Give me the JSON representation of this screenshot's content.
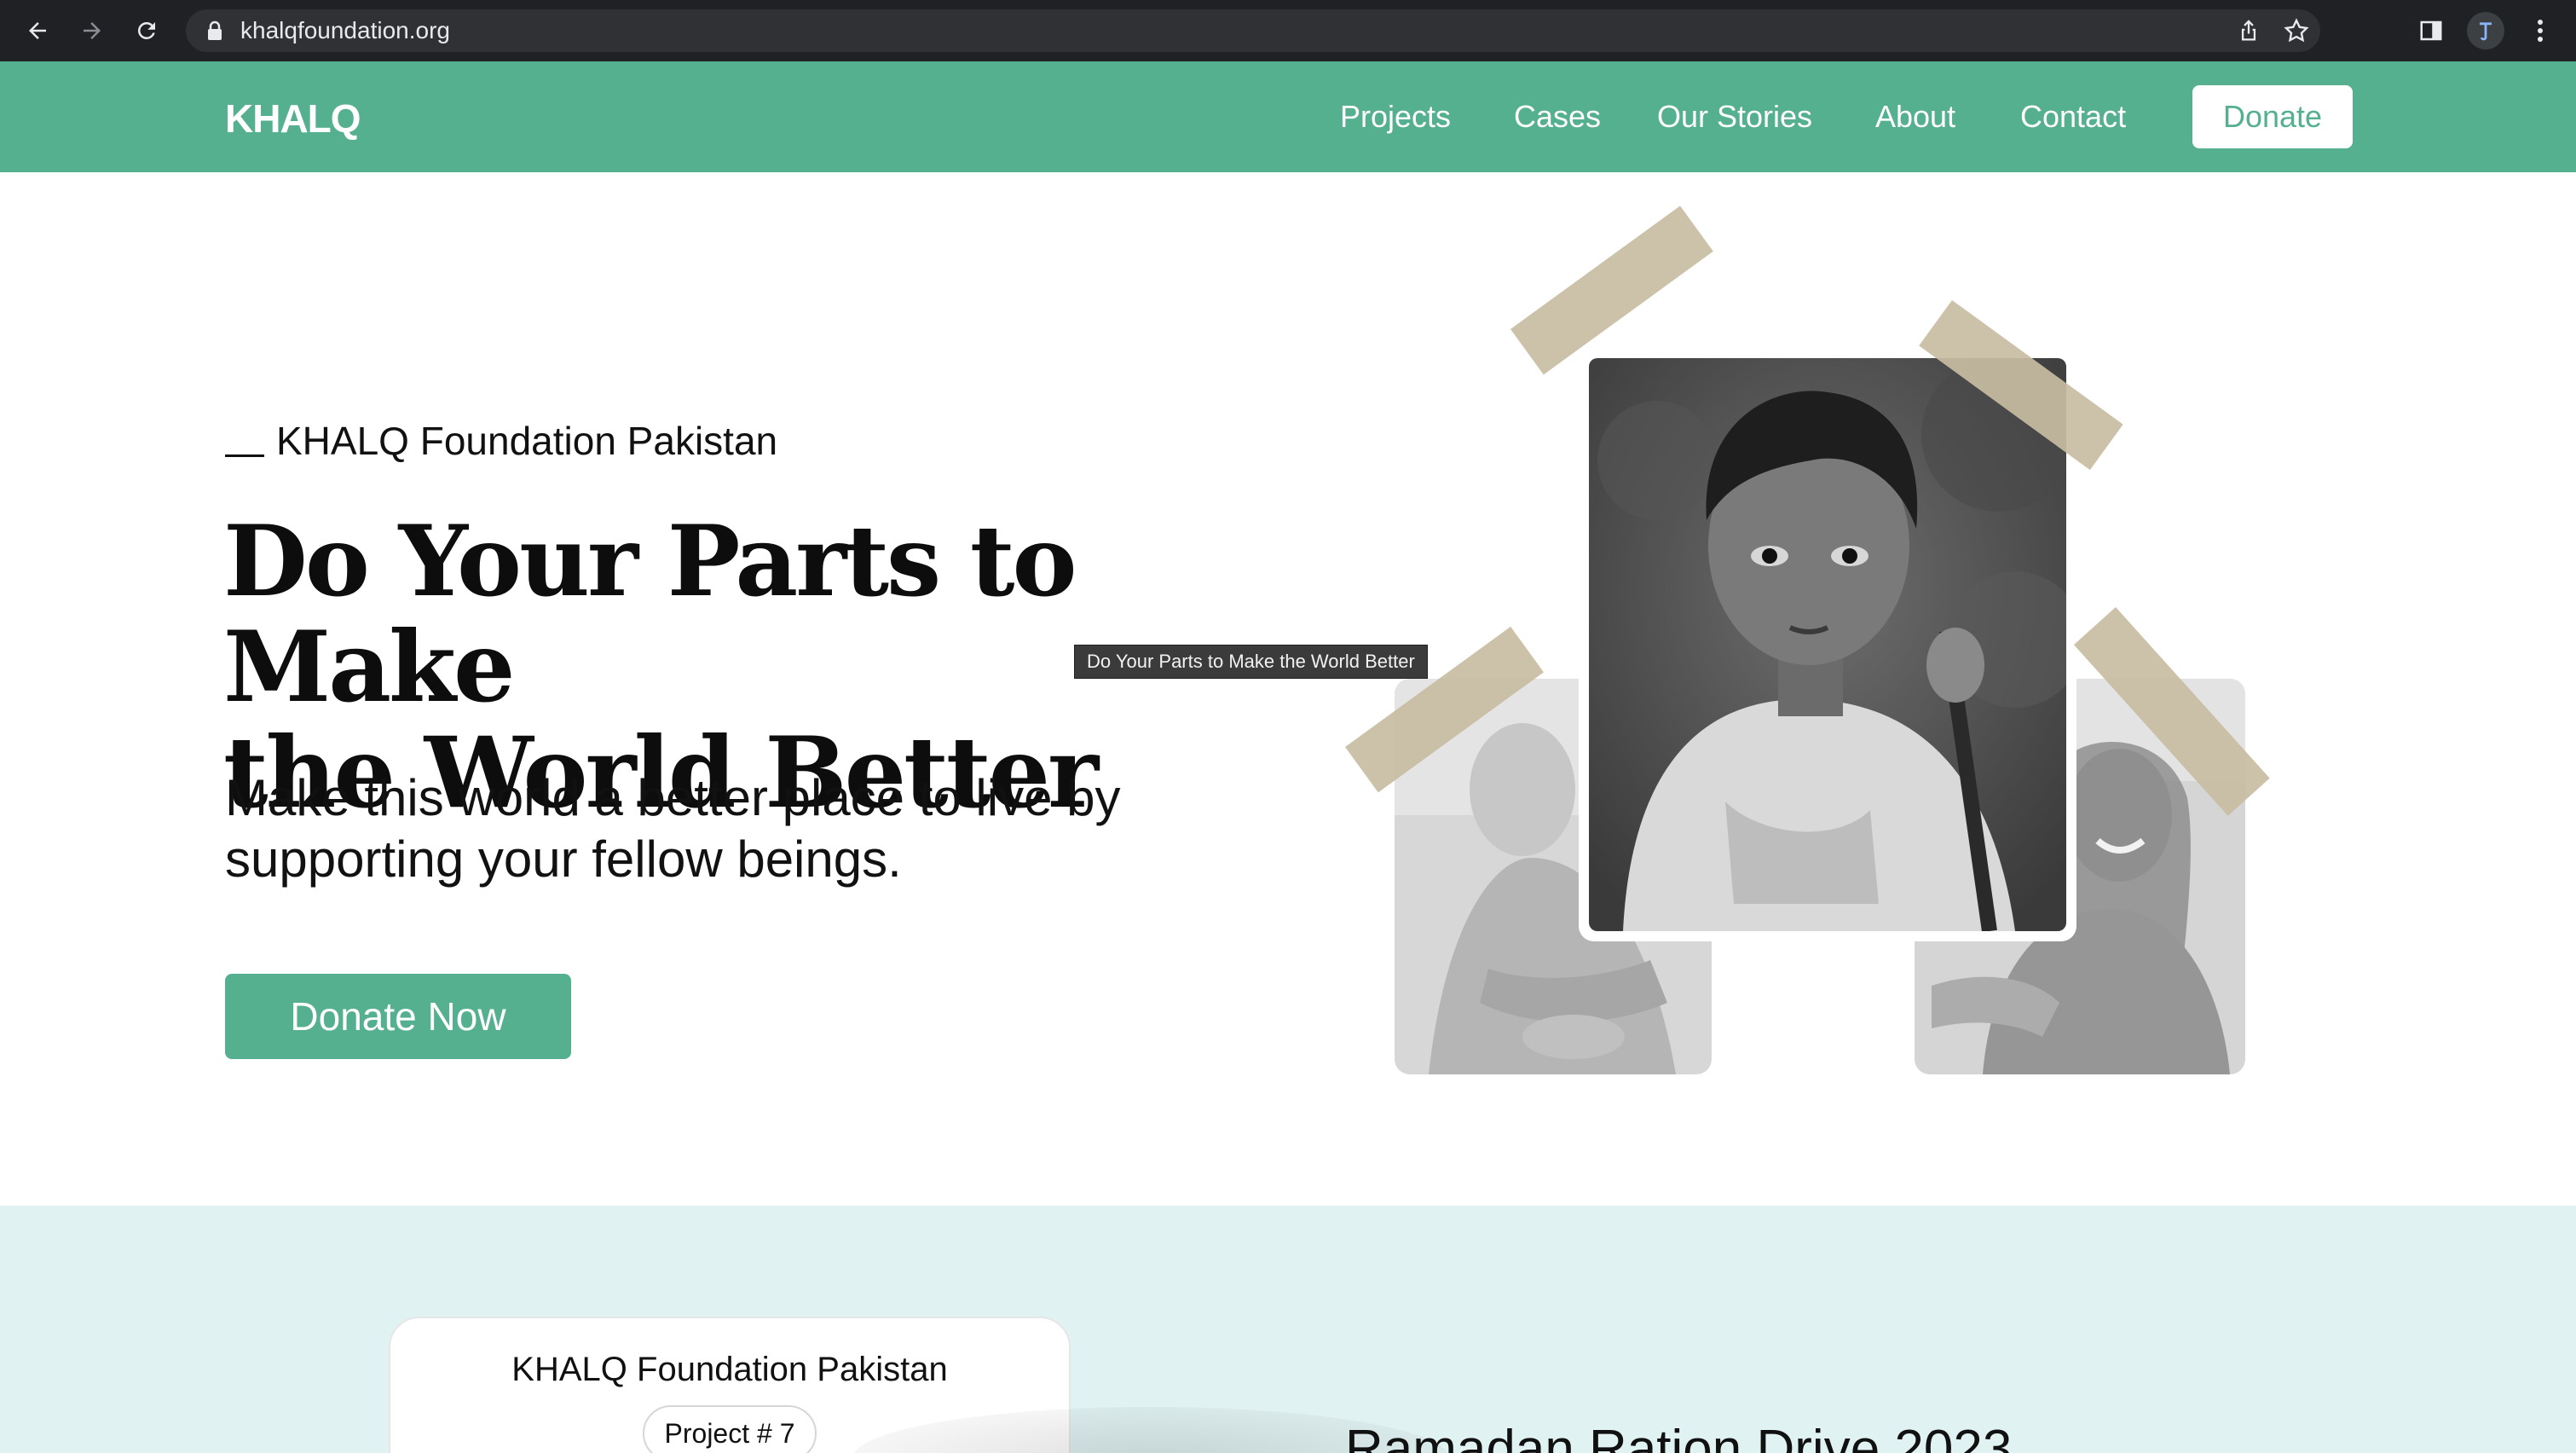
{
  "browser": {
    "url": "khalqfoundation.org"
  },
  "nav": {
    "logo": "KHALQ",
    "links": [
      "Projects",
      "Cases",
      "Our Stories",
      "About",
      "Contact"
    ],
    "donate_label": "Donate"
  },
  "hero": {
    "eyebrow": "KHALQ Foundation Pakistan",
    "headline_line1": "Do Your Parts to Make",
    "headline_line2": "the World Better",
    "tooltip": "Do Your Parts to Make the World Better",
    "subtext_line1": "Make this world a better place to live by",
    "subtext_line2": "supporting your fellow beings.",
    "cta_label": "Donate Now"
  },
  "lower": {
    "card_title": "KHALQ Foundation Pakistan",
    "card_badge": "Project # 7",
    "drive_title": "Ramadan Ration Drive 2023"
  },
  "colors": {
    "brand_green": "#55b090",
    "lower_bg": "#e1f2f3",
    "chrome_bg": "#202124"
  }
}
